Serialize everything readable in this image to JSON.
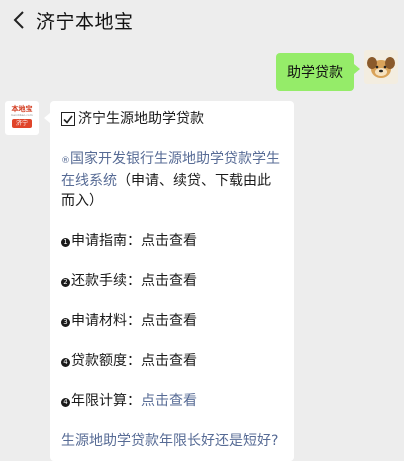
{
  "header": {
    "title": "济宁本地宝",
    "back_icon": "chevron-left-icon"
  },
  "outgoing": {
    "text": "助学贷款",
    "avatar": "dog-avatar"
  },
  "incoming": {
    "avatar_logo": "本地宝",
    "avatar_sub": "bendibao.com",
    "avatar_city": "济宁",
    "heading": "济宁生源地助学贷款",
    "intro_marker": "®",
    "intro_link": "国家开发银行生源地助学贷款学生在线系统",
    "intro_rest": "（申请、续贷、下载由此而入）",
    "items": [
      {
        "marker": "1",
        "label": "申请指南：",
        "action": "点击查看",
        "action_is_link": false
      },
      {
        "marker": "2",
        "label": "还款手续：",
        "action": "点击查看",
        "action_is_link": false
      },
      {
        "marker": "3",
        "label": "申请材料：",
        "action": "点击查看",
        "action_is_link": false
      },
      {
        "marker": "4",
        "label": "贷款额度：",
        "action": "点击查看",
        "action_is_link": false
      },
      {
        "marker": "4",
        "label": "年限计算：",
        "action": "点击查看",
        "action_is_link": true
      }
    ],
    "footer_link": "生源地助学贷款年限长好还是短好?"
  },
  "colors": {
    "background": "#ededed",
    "bubble_out": "#95ec69",
    "link": "#576b95",
    "brand_red": "#e0442a"
  }
}
